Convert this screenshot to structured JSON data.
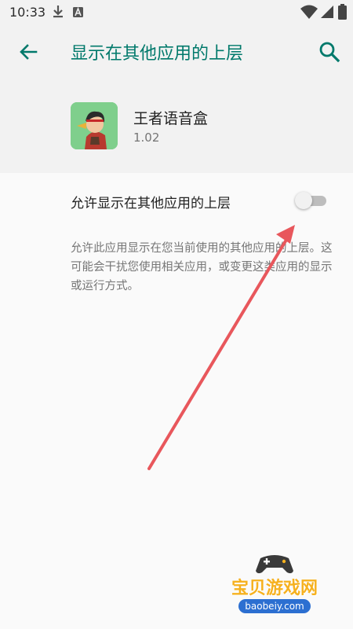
{
  "status_bar": {
    "time": "10:33",
    "icons": [
      "download-icon",
      "a-badge-icon",
      "wifi-icon",
      "signal-icon",
      "battery-icon"
    ]
  },
  "app_bar": {
    "title": "显示在其他应用的上层",
    "back_icon": "arrow-left-icon",
    "search_icon": "search-icon",
    "accent_color": "#00796b"
  },
  "app_info": {
    "name": "王者语音盒",
    "version": "1.02"
  },
  "permission": {
    "label": "允许显示在其他应用的上层",
    "enabled": false,
    "summary": "允许此应用显示在您当前使用的其他应用的上层。这可能会干扰您使用相关应用，或变更这类应用的显示或运行方式。"
  },
  "annotation": {
    "arrow_color": "#e8575c"
  },
  "watermark": {
    "text": "宝贝游戏网",
    "url": "baobeiy.com"
  }
}
